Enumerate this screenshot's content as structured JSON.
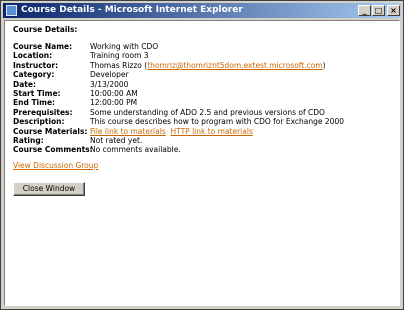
{
  "window": {
    "title": "Course Details - Microsoft Internet Explorer",
    "minimize_glyph": "_",
    "maximize_glyph": "□",
    "close_glyph": "×"
  },
  "page": {
    "heading": "Course Details:",
    "fields": {
      "course_name": {
        "label": "Course Name:",
        "value": "Working with CDO"
      },
      "location": {
        "label": "Location:",
        "value": "Training room 3"
      },
      "instructor": {
        "label": "Instructor:",
        "value": "Thomas Rizzo (",
        "email": "thomriz@thomriznt5dom.extest.microsoft.com",
        "suffix": ")"
      },
      "category": {
        "label": "Category:",
        "value": "Developer"
      },
      "date": {
        "label": "Date:",
        "value": "3/13/2000"
      },
      "start_time": {
        "label": "Start Time:",
        "value": "10:00:00 AM"
      },
      "end_time": {
        "label": "End Time:",
        "value": "12:00:00 PM"
      },
      "prerequisites": {
        "label": "Prerequisites:",
        "value": "Some understanding of ADO 2.5 and previous versions of CDO"
      },
      "description": {
        "label": "Description:",
        "value": "This course describes how to program with CDO for Exchange 2000"
      },
      "materials": {
        "label": "Course Materials:",
        "file_link": "File link to materials",
        "http_link": "HTTP link to materials"
      },
      "rating": {
        "label": "Rating:",
        "value": "Not rated yet."
      },
      "comments": {
        "label": "Course Comments:",
        "value": "No comments available."
      }
    },
    "discussion_link": "View Discussion Group",
    "close_button": "Close Window"
  },
  "colors": {
    "titlebar_start": "#0a246a",
    "titlebar_end": "#a6caf0",
    "link": "#cc6600",
    "chrome": "#d4d0c8"
  }
}
